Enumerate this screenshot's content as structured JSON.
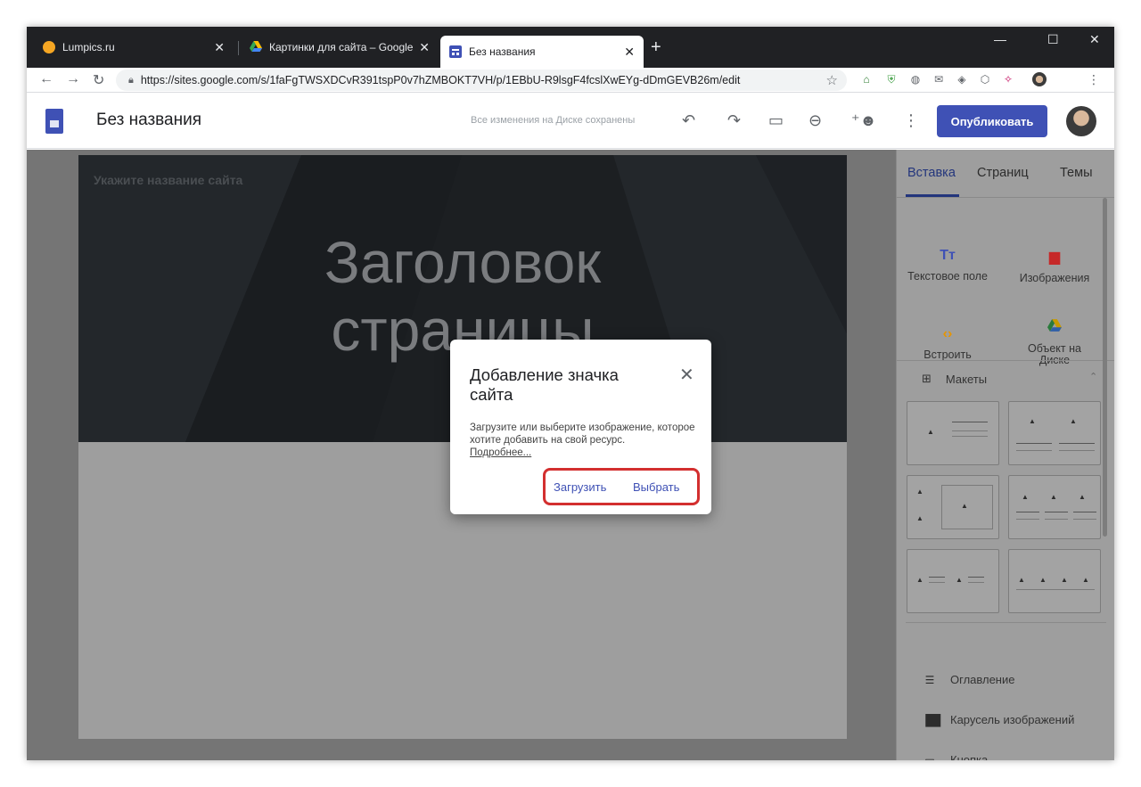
{
  "browser": {
    "tabs": [
      {
        "title": "Lumpics.ru",
        "icon": "lumpics-favicon"
      },
      {
        "title": "Картинки для сайта – Google Д",
        "icon": "google-drive-icon"
      },
      {
        "title": "Без названия",
        "icon": "google-sites-icon"
      }
    ],
    "new_tab": "+",
    "url": "https://sites.google.com/s/1faFgTWSXDCvR391tspP0v7hZMBOKT7VH/p/1EBbU-R9lsgF4fcslXwEYg-dDmGEVB26m/edit"
  },
  "app": {
    "doc_title": "Без названия",
    "save_status": "Все изменения на Диске сохранены",
    "publish_label": "Опубликовать"
  },
  "page": {
    "site_name_placeholder": "Укажите название сайта",
    "heading_line1": "Заголовок",
    "heading_line2": "страницы"
  },
  "panel": {
    "tabs": [
      "Вставка",
      "Страниц",
      "Темы"
    ],
    "tools": [
      {
        "label": "Текстовое поле",
        "icon": "text-box-icon"
      },
      {
        "label": "Изображения",
        "icon": "image-icon"
      },
      {
        "label": "Встроить",
        "icon": "embed-icon"
      },
      {
        "label_line1": "Объект на",
        "label_line2": "Диске",
        "icon": "drive-icon"
      }
    ],
    "layouts_label": "Макеты",
    "components": [
      {
        "label": "Оглавление",
        "icon": "toc-icon"
      },
      {
        "label": "Карусель изображений",
        "icon": "carousel-icon"
      },
      {
        "label": "Кнопка",
        "icon": "button-icon"
      }
    ]
  },
  "dialog": {
    "title": "Добавление значка сайта",
    "body": "Загрузите или выберите изображение, которое хотите добавить на свой ресурс.",
    "link": "Подробнее...",
    "upload_label": "Загрузить",
    "select_label": "Выбрать"
  },
  "colors": {
    "accent": "#3f51b5",
    "highlight": "#d32f2f",
    "tabbar": "#202124"
  }
}
